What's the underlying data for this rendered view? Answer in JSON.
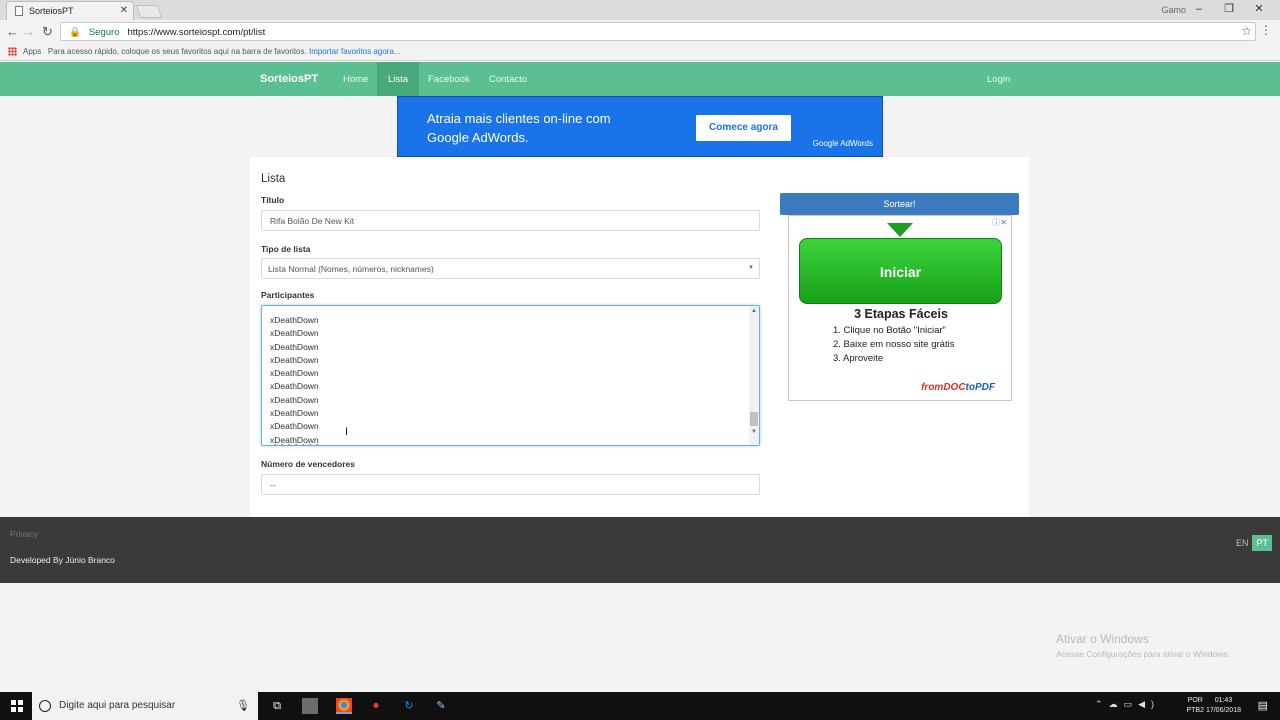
{
  "browser": {
    "tab_title": "SorteiosPT",
    "tab_close": "✕",
    "window_user": "Gamo",
    "omnibox_secure": "Seguro",
    "omnibox_url": "https://www.sorteiospt.com/pt/list",
    "bookmarks_apps": "Apps",
    "bookmarks_hint": "Para acesso rápido, coloque os seus favoritos aqui na barra de favoritos.",
    "bookmarks_import": "Importar favoritos agora..."
  },
  "nav": {
    "brand": "SorteiosPT",
    "links": [
      "Home",
      "Lista",
      "Facebook",
      "Contacto"
    ],
    "login": "Login"
  },
  "top_ad": {
    "text": "Atraia mais clientes on-line com Google AdWords.",
    "cta": "Comece agora",
    "brand": "Google AdWords"
  },
  "form": {
    "heading": "Lista",
    "titulo_label": "Título",
    "titulo_value": "Rifa Bolão De New Kit",
    "tipo_label": "Tipo de lista",
    "tipo_value": "Lista Normal (Nomes, números, nicknames)",
    "participantes_label": "Participantes",
    "participantes": [
      "xDeathDown",
      "xDeathDown",
      "xDeathDown",
      "xDeathDown",
      "xDeathDown",
      "xDeathDown",
      "xDeathDown",
      "xDeathDown",
      "xDeathDown",
      "xDeathDown"
    ],
    "vencedores_label": "Número de vencedores",
    "vencedores_value": "--"
  },
  "sortear_button": "Sortear!",
  "side_ad": {
    "button": "Iniciar",
    "heading": "3 Etapas Fáceis",
    "steps": [
      "1. Clique no Botão \"Iniciar\"",
      "2. Baixe em nosso site grátis",
      "3. Aproveite"
    ],
    "logo_a": "fromDOC",
    "logo_b": "toPDF"
  },
  "footer": {
    "privacy": "Privacy",
    "developed": "Developed By Júnio Branco",
    "lang_en": "EN",
    "lang_pt": "PT"
  },
  "watermark": {
    "title": "Ativar o Windows",
    "subtitle": "Acesse Configurações para ativar o Windows."
  },
  "taskbar": {
    "search_placeholder": "Digite aqui para pesquisar",
    "lang_line1": "POR",
    "lang_line2": "PTB2",
    "time": "01:43",
    "date": "17/06/2018"
  },
  "colors": {
    "nav_green": "#5cbf91",
    "ad_blue": "#1a73e8",
    "sortear_blue": "#3c7bbf"
  }
}
